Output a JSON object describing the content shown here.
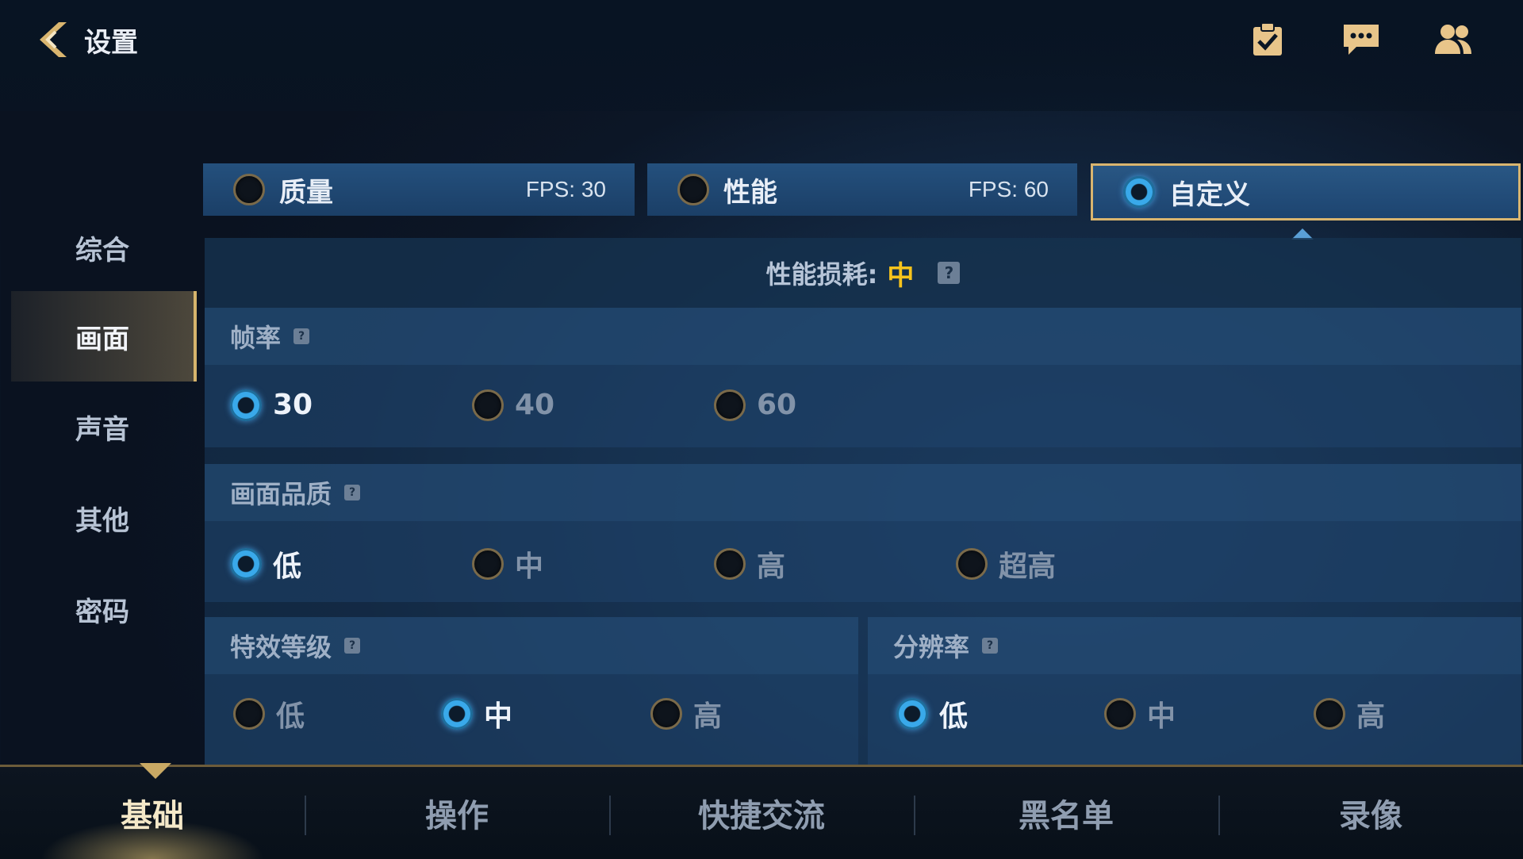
{
  "header": {
    "back_label": "设置",
    "icons": [
      "checklist-icon",
      "chat-icon",
      "friends-icon"
    ]
  },
  "sidebar": {
    "items": [
      {
        "label": "综合",
        "active": false
      },
      {
        "label": "画面",
        "active": true
      },
      {
        "label": "声音",
        "active": false
      },
      {
        "label": "其他",
        "active": false
      },
      {
        "label": "密码",
        "active": false
      }
    ]
  },
  "presets": [
    {
      "name": "质量",
      "fps": "FPS: 30",
      "selected": false
    },
    {
      "name": "性能",
      "fps": "FPS: 60",
      "selected": false
    },
    {
      "name": "自定义",
      "fps": "",
      "selected": true
    }
  ],
  "performance": {
    "label": "性能损耗:",
    "value": "中",
    "help": "?"
  },
  "frame_rate": {
    "title": "帧率",
    "options": [
      "30",
      "40",
      "60"
    ],
    "selected": "30"
  },
  "quality": {
    "title": "画面品质",
    "options": [
      "低",
      "中",
      "高",
      "超高"
    ],
    "selected": "低"
  },
  "effects": {
    "title": "特效等级",
    "options": [
      "低",
      "中",
      "高"
    ],
    "selected": "中"
  },
  "resolution": {
    "title": "分辨率",
    "options": [
      "低",
      "中",
      "高"
    ],
    "selected": "低"
  },
  "tabs": [
    {
      "label": "基础",
      "active": true
    },
    {
      "label": "操作",
      "active": false
    },
    {
      "label": "快捷交流",
      "active": false
    },
    {
      "label": "黑名单",
      "active": false
    },
    {
      "label": "录像",
      "active": false
    }
  ],
  "colors": {
    "accent_gold": "#d9b56f",
    "value_yellow": "#f7c31c",
    "radio_blue": "#39a9ea"
  }
}
